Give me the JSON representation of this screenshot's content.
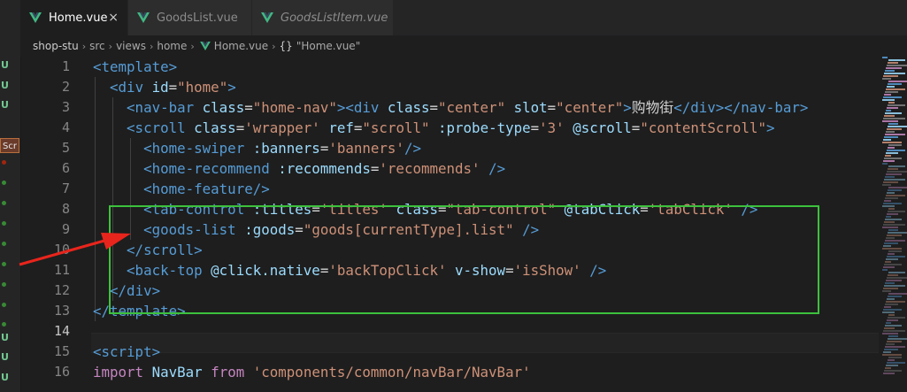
{
  "tabs": [
    {
      "label": "Home.vue",
      "active": true,
      "close_glyph": "×"
    },
    {
      "label": "GoodsList.vue",
      "active": false
    },
    {
      "label": "GoodsListItem.vue",
      "active": false
    }
  ],
  "breadcrumb": {
    "folder": "shop-stu",
    "sub1": "src",
    "sub2": "views",
    "sub3": "home",
    "file": "Home.vue",
    "symbol_brace": "{}",
    "symbol": "\"Home.vue\""
  },
  "left_strip": {
    "status_letters": [
      "U",
      "U",
      "U"
    ],
    "badge": "Scr",
    "status_letters_bottom": [
      "U",
      "U",
      "U"
    ]
  },
  "line_numbers": [
    "1",
    "2",
    "3",
    "4",
    "5",
    "6",
    "7",
    "8",
    "9",
    "10",
    "11",
    "12",
    "13",
    "14",
    "15",
    "16"
  ],
  "current_line": "14",
  "code": [
    [
      [
        "tag",
        "<template>"
      ]
    ],
    [
      [
        "text",
        "  "
      ],
      [
        "tag",
        "<div"
      ],
      [
        "text",
        " "
      ],
      [
        "attr",
        "id"
      ],
      [
        "text",
        "="
      ],
      [
        "str",
        "\"home\""
      ],
      [
        "tag",
        ">"
      ]
    ],
    [
      [
        "text",
        "    "
      ],
      [
        "tag",
        "<nav-bar"
      ],
      [
        "text",
        " "
      ],
      [
        "attr",
        "class"
      ],
      [
        "text",
        "="
      ],
      [
        "str",
        "\"home-nav\""
      ],
      [
        "tag",
        "><div"
      ],
      [
        "text",
        " "
      ],
      [
        "attr",
        "class"
      ],
      [
        "text",
        "="
      ],
      [
        "str",
        "\"center\""
      ],
      [
        "text",
        " "
      ],
      [
        "attr",
        "slot"
      ],
      [
        "text",
        "="
      ],
      [
        "str",
        "\"center\""
      ],
      [
        "tag",
        ">"
      ],
      [
        "text",
        "购物街"
      ],
      [
        "tag",
        "</div></nav-bar>"
      ]
    ],
    [
      [
        "text",
        "    "
      ],
      [
        "tag",
        "<scroll"
      ],
      [
        "text",
        " "
      ],
      [
        "attr",
        "class"
      ],
      [
        "text",
        "="
      ],
      [
        "str",
        "'wrapper'"
      ],
      [
        "text",
        " "
      ],
      [
        "attr",
        "ref"
      ],
      [
        "text",
        "="
      ],
      [
        "str",
        "\"scroll\""
      ],
      [
        "text",
        " "
      ],
      [
        "attr",
        ":probe-type"
      ],
      [
        "text",
        "="
      ],
      [
        "str",
        "'3'"
      ],
      [
        "text",
        " "
      ],
      [
        "attr",
        "@scroll"
      ],
      [
        "text",
        "="
      ],
      [
        "str",
        "\"contentScroll\""
      ],
      [
        "tag",
        ">"
      ]
    ],
    [
      [
        "text",
        "      "
      ],
      [
        "tag",
        "<home-swiper"
      ],
      [
        "text",
        " "
      ],
      [
        "attr",
        ":banners"
      ],
      [
        "text",
        "="
      ],
      [
        "str",
        "'banners'"
      ],
      [
        "tag",
        "/>"
      ]
    ],
    [
      [
        "text",
        "      "
      ],
      [
        "tag",
        "<home-recommend"
      ],
      [
        "text",
        " "
      ],
      [
        "attr",
        ":recommends"
      ],
      [
        "text",
        "="
      ],
      [
        "str",
        "'recommends'"
      ],
      [
        "text",
        " "
      ],
      [
        "tag",
        "/>"
      ]
    ],
    [
      [
        "text",
        "      "
      ],
      [
        "tag",
        "<home-feature/>"
      ]
    ],
    [
      [
        "text",
        "      "
      ],
      [
        "tag",
        "<tab-control"
      ],
      [
        "text",
        " "
      ],
      [
        "attr",
        ":titles"
      ],
      [
        "text",
        "="
      ],
      [
        "str",
        "'titles'"
      ],
      [
        "text",
        " "
      ],
      [
        "attr",
        "class"
      ],
      [
        "text",
        "="
      ],
      [
        "str",
        "\"tab-control\""
      ],
      [
        "text",
        " "
      ],
      [
        "attr",
        "@tabClick"
      ],
      [
        "text",
        "="
      ],
      [
        "str",
        "'tabClick'"
      ],
      [
        "text",
        " "
      ],
      [
        "tag",
        "/>"
      ]
    ],
    [
      [
        "text",
        "      "
      ],
      [
        "tag",
        "<goods-list"
      ],
      [
        "text",
        " "
      ],
      [
        "attr",
        ":goods"
      ],
      [
        "text",
        "="
      ],
      [
        "str",
        "\"goods[currentType].list\""
      ],
      [
        "text",
        " "
      ],
      [
        "tag",
        "/>"
      ]
    ],
    [
      [
        "text",
        "    "
      ],
      [
        "tag",
        "</scroll>"
      ]
    ],
    [
      [
        "text",
        "    "
      ],
      [
        "tag",
        "<back-top"
      ],
      [
        "text",
        " "
      ],
      [
        "attr",
        "@click.native"
      ],
      [
        "text",
        "="
      ],
      [
        "str",
        "'backTopClick'"
      ],
      [
        "text",
        " "
      ],
      [
        "attr",
        "v-show"
      ],
      [
        "text",
        "="
      ],
      [
        "str",
        "'isShow'"
      ],
      [
        "text",
        " "
      ],
      [
        "tag",
        "/>"
      ]
    ],
    [
      [
        "text",
        "  "
      ],
      [
        "tag",
        "</div>"
      ]
    ],
    [
      [
        "tag",
        "</template>"
      ]
    ],
    [],
    [
      [
        "tag",
        "<script>"
      ]
    ],
    [
      [
        "kw",
        "import"
      ],
      [
        "text",
        " "
      ],
      [
        "id",
        "NavBar"
      ],
      [
        "text",
        " "
      ],
      [
        "kw",
        "from"
      ],
      [
        "text",
        " "
      ],
      [
        "str",
        "'components/common/navBar/NavBar'"
      ]
    ]
  ],
  "colors": {
    "tag": "#569cd6",
    "attr": "#9cdcfe",
    "string": "#ce9178",
    "keyword": "#c586c0",
    "annotation_box": "#3cc13c",
    "annotation_arrow": "#e8251c"
  },
  "icons": [
    "vue-logo-icon",
    "close-icon",
    "chevron-right-icon",
    "braces-symbol-icon"
  ]
}
